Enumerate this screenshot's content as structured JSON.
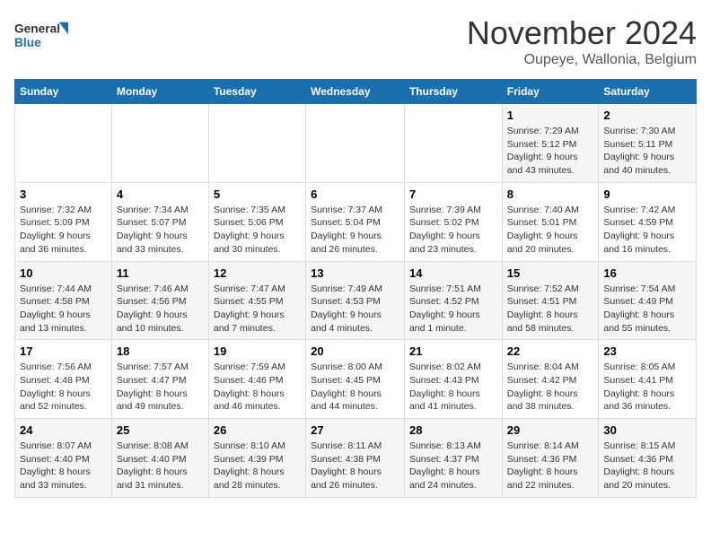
{
  "logo": {
    "line1": "General",
    "line2": "Blue"
  },
  "title": "November 2024",
  "subtitle": "Oupeye, Wallonia, Belgium",
  "days_of_week": [
    "Sunday",
    "Monday",
    "Tuesday",
    "Wednesday",
    "Thursday",
    "Friday",
    "Saturday"
  ],
  "weeks": [
    [
      {
        "day": "",
        "info": ""
      },
      {
        "day": "",
        "info": ""
      },
      {
        "day": "",
        "info": ""
      },
      {
        "day": "",
        "info": ""
      },
      {
        "day": "",
        "info": ""
      },
      {
        "day": "1",
        "info": "Sunrise: 7:29 AM\nSunset: 5:12 PM\nDaylight: 9 hours and 43 minutes."
      },
      {
        "day": "2",
        "info": "Sunrise: 7:30 AM\nSunset: 5:11 PM\nDaylight: 9 hours and 40 minutes."
      }
    ],
    [
      {
        "day": "3",
        "info": "Sunrise: 7:32 AM\nSunset: 5:09 PM\nDaylight: 9 hours and 36 minutes."
      },
      {
        "day": "4",
        "info": "Sunrise: 7:34 AM\nSunset: 5:07 PM\nDaylight: 9 hours and 33 minutes."
      },
      {
        "day": "5",
        "info": "Sunrise: 7:35 AM\nSunset: 5:06 PM\nDaylight: 9 hours and 30 minutes."
      },
      {
        "day": "6",
        "info": "Sunrise: 7:37 AM\nSunset: 5:04 PM\nDaylight: 9 hours and 26 minutes."
      },
      {
        "day": "7",
        "info": "Sunrise: 7:39 AM\nSunset: 5:02 PM\nDaylight: 9 hours and 23 minutes."
      },
      {
        "day": "8",
        "info": "Sunrise: 7:40 AM\nSunset: 5:01 PM\nDaylight: 9 hours and 20 minutes."
      },
      {
        "day": "9",
        "info": "Sunrise: 7:42 AM\nSunset: 4:59 PM\nDaylight: 9 hours and 16 minutes."
      }
    ],
    [
      {
        "day": "10",
        "info": "Sunrise: 7:44 AM\nSunset: 4:58 PM\nDaylight: 9 hours and 13 minutes."
      },
      {
        "day": "11",
        "info": "Sunrise: 7:46 AM\nSunset: 4:56 PM\nDaylight: 9 hours and 10 minutes."
      },
      {
        "day": "12",
        "info": "Sunrise: 7:47 AM\nSunset: 4:55 PM\nDaylight: 9 hours and 7 minutes."
      },
      {
        "day": "13",
        "info": "Sunrise: 7:49 AM\nSunset: 4:53 PM\nDaylight: 9 hours and 4 minutes."
      },
      {
        "day": "14",
        "info": "Sunrise: 7:51 AM\nSunset: 4:52 PM\nDaylight: 9 hours and 1 minute."
      },
      {
        "day": "15",
        "info": "Sunrise: 7:52 AM\nSunset: 4:51 PM\nDaylight: 8 hours and 58 minutes."
      },
      {
        "day": "16",
        "info": "Sunrise: 7:54 AM\nSunset: 4:49 PM\nDaylight: 8 hours and 55 minutes."
      }
    ],
    [
      {
        "day": "17",
        "info": "Sunrise: 7:56 AM\nSunset: 4:48 PM\nDaylight: 8 hours and 52 minutes."
      },
      {
        "day": "18",
        "info": "Sunrise: 7:57 AM\nSunset: 4:47 PM\nDaylight: 8 hours and 49 minutes."
      },
      {
        "day": "19",
        "info": "Sunrise: 7:59 AM\nSunset: 4:46 PM\nDaylight: 8 hours and 46 minutes."
      },
      {
        "day": "20",
        "info": "Sunrise: 8:00 AM\nSunset: 4:45 PM\nDaylight: 8 hours and 44 minutes."
      },
      {
        "day": "21",
        "info": "Sunrise: 8:02 AM\nSunset: 4:43 PM\nDaylight: 8 hours and 41 minutes."
      },
      {
        "day": "22",
        "info": "Sunrise: 8:04 AM\nSunset: 4:42 PM\nDaylight: 8 hours and 38 minutes."
      },
      {
        "day": "23",
        "info": "Sunrise: 8:05 AM\nSunset: 4:41 PM\nDaylight: 8 hours and 36 minutes."
      }
    ],
    [
      {
        "day": "24",
        "info": "Sunrise: 8:07 AM\nSunset: 4:40 PM\nDaylight: 8 hours and 33 minutes."
      },
      {
        "day": "25",
        "info": "Sunrise: 8:08 AM\nSunset: 4:40 PM\nDaylight: 8 hours and 31 minutes."
      },
      {
        "day": "26",
        "info": "Sunrise: 8:10 AM\nSunset: 4:39 PM\nDaylight: 8 hours and 28 minutes."
      },
      {
        "day": "27",
        "info": "Sunrise: 8:11 AM\nSunset: 4:38 PM\nDaylight: 8 hours and 26 minutes."
      },
      {
        "day": "28",
        "info": "Sunrise: 8:13 AM\nSunset: 4:37 PM\nDaylight: 8 hours and 24 minutes."
      },
      {
        "day": "29",
        "info": "Sunrise: 8:14 AM\nSunset: 4:36 PM\nDaylight: 8 hours and 22 minutes."
      },
      {
        "day": "30",
        "info": "Sunrise: 8:15 AM\nSunset: 4:36 PM\nDaylight: 8 hours and 20 minutes."
      }
    ]
  ]
}
